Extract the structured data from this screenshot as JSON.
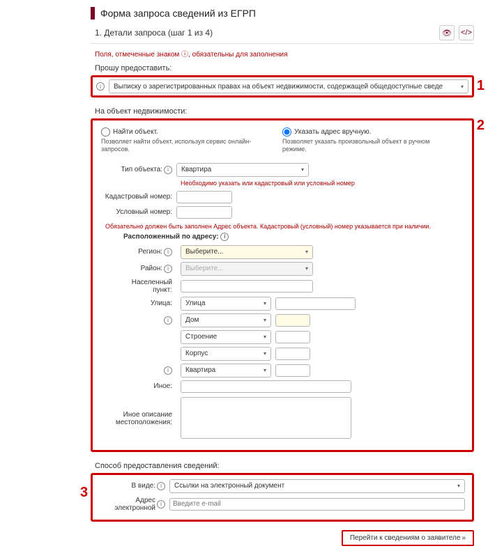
{
  "title": "Форма запроса сведений из ЕГРП",
  "step": "1. Детали запроса (шаг 1 из 4)",
  "required_note": "Поля, отмеченные знаком ⓘ, обязательны для заполнения",
  "provide_label": "Прошу предоставить:",
  "provide_select": "Выписку о зарегистрированных правах на объект недвижимости, содержащей общедоступные сведе",
  "object_section": "На объект недвижимости:",
  "radio_find": {
    "label": "Найти объект.",
    "desc": "Позволяет найти объект, используя сервис онлайн-запросов."
  },
  "radio_manual": {
    "label": "Указать адрес вручную.",
    "desc": "Позволяет указать произвольный объект в ручном режиме."
  },
  "type_label": "Тип объекта:",
  "type_value": "Квартира",
  "type_warn": "Необходимо указать или кадастровый или условный номер",
  "cad_label": "Кадастровый номер:",
  "cond_label": "Условный номер:",
  "addr_warn": "Обязательно должен быть заполнен Адрес объекта. Кадастровый (условный) номер указывается при наличии.",
  "addr_head": "Расположенный по адресу:",
  "region_label": "Регион:",
  "region_value": "Выберите...",
  "district_label": "Район:",
  "district_value": "Выберите...",
  "settlement_label": "Населенный пункт:",
  "street_label": "Улица:",
  "street_value": "Улица",
  "house_value": "Дом",
  "building_value": "Строение",
  "korpus_value": "Корпус",
  "flat_value": "Квартира",
  "other_label": "Иное:",
  "other_desc_label": "Иное описание местоположения:",
  "delivery_section": "Способ предоставления сведений:",
  "form_label": "В виде:",
  "form_value": "Ссылки на электронный документ",
  "email_label": "Адрес электронной",
  "email_placeholder": "Введите e-mail",
  "next_button": "Перейти к сведениям о заявителе",
  "callouts": {
    "one": "1",
    "two": "2",
    "three": "3"
  },
  "icons": {
    "info": "i",
    "chev": "▾",
    "eye": "👁",
    "code": "</>"
  }
}
